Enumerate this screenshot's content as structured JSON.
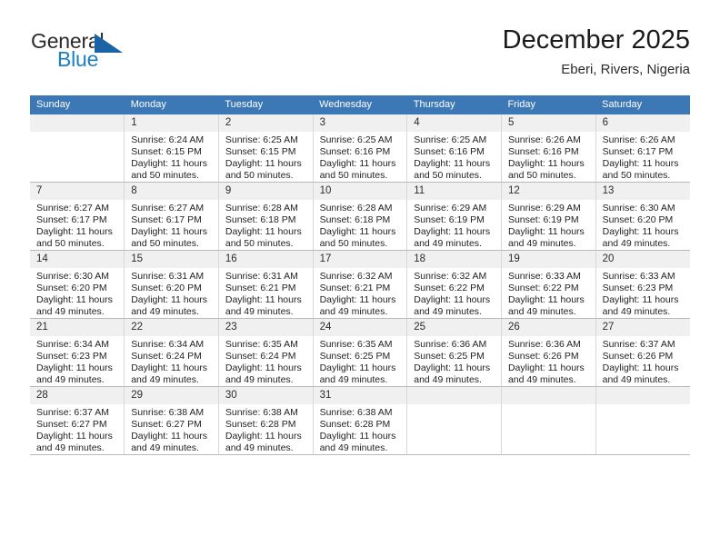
{
  "brand": {
    "word1": "General",
    "word2": "Blue",
    "flag_icon": "blue-triangle-flag-icon",
    "colors": {
      "general": "#2b2b2b",
      "blue": "#1d7fc3",
      "flag": "#1b63a5"
    }
  },
  "header": {
    "title": "December 2025",
    "subtitle": "Eberi, Rivers, Nigeria"
  },
  "theme": {
    "header_row_bg": "#3b78b5",
    "header_row_text": "#ffffff",
    "daynum_bg": "#f0f0f0",
    "cell_border": "#d8d8d8"
  },
  "weekdays": [
    "Sunday",
    "Monday",
    "Tuesday",
    "Wednesday",
    "Thursday",
    "Friday",
    "Saturday"
  ],
  "weeks": [
    [
      {
        "day": "",
        "sunrise": "",
        "sunset": "",
        "daylight_line1": "",
        "daylight_line2": ""
      },
      {
        "day": "1",
        "sunrise": "Sunrise: 6:24 AM",
        "sunset": "Sunset: 6:15 PM",
        "daylight_line1": "Daylight: 11 hours",
        "daylight_line2": "and 50 minutes."
      },
      {
        "day": "2",
        "sunrise": "Sunrise: 6:25 AM",
        "sunset": "Sunset: 6:15 PM",
        "daylight_line1": "Daylight: 11 hours",
        "daylight_line2": "and 50 minutes."
      },
      {
        "day": "3",
        "sunrise": "Sunrise: 6:25 AM",
        "sunset": "Sunset: 6:16 PM",
        "daylight_line1": "Daylight: 11 hours",
        "daylight_line2": "and 50 minutes."
      },
      {
        "day": "4",
        "sunrise": "Sunrise: 6:25 AM",
        "sunset": "Sunset: 6:16 PM",
        "daylight_line1": "Daylight: 11 hours",
        "daylight_line2": "and 50 minutes."
      },
      {
        "day": "5",
        "sunrise": "Sunrise: 6:26 AM",
        "sunset": "Sunset: 6:16 PM",
        "daylight_line1": "Daylight: 11 hours",
        "daylight_line2": "and 50 minutes."
      },
      {
        "day": "6",
        "sunrise": "Sunrise: 6:26 AM",
        "sunset": "Sunset: 6:17 PM",
        "daylight_line1": "Daylight: 11 hours",
        "daylight_line2": "and 50 minutes."
      }
    ],
    [
      {
        "day": "7",
        "sunrise": "Sunrise: 6:27 AM",
        "sunset": "Sunset: 6:17 PM",
        "daylight_line1": "Daylight: 11 hours",
        "daylight_line2": "and 50 minutes."
      },
      {
        "day": "8",
        "sunrise": "Sunrise: 6:27 AM",
        "sunset": "Sunset: 6:17 PM",
        "daylight_line1": "Daylight: 11 hours",
        "daylight_line2": "and 50 minutes."
      },
      {
        "day": "9",
        "sunrise": "Sunrise: 6:28 AM",
        "sunset": "Sunset: 6:18 PM",
        "daylight_line1": "Daylight: 11 hours",
        "daylight_line2": "and 50 minutes."
      },
      {
        "day": "10",
        "sunrise": "Sunrise: 6:28 AM",
        "sunset": "Sunset: 6:18 PM",
        "daylight_line1": "Daylight: 11 hours",
        "daylight_line2": "and 50 minutes."
      },
      {
        "day": "11",
        "sunrise": "Sunrise: 6:29 AM",
        "sunset": "Sunset: 6:19 PM",
        "daylight_line1": "Daylight: 11 hours",
        "daylight_line2": "and 49 minutes."
      },
      {
        "day": "12",
        "sunrise": "Sunrise: 6:29 AM",
        "sunset": "Sunset: 6:19 PM",
        "daylight_line1": "Daylight: 11 hours",
        "daylight_line2": "and 49 minutes."
      },
      {
        "day": "13",
        "sunrise": "Sunrise: 6:30 AM",
        "sunset": "Sunset: 6:20 PM",
        "daylight_line1": "Daylight: 11 hours",
        "daylight_line2": "and 49 minutes."
      }
    ],
    [
      {
        "day": "14",
        "sunrise": "Sunrise: 6:30 AM",
        "sunset": "Sunset: 6:20 PM",
        "daylight_line1": "Daylight: 11 hours",
        "daylight_line2": "and 49 minutes."
      },
      {
        "day": "15",
        "sunrise": "Sunrise: 6:31 AM",
        "sunset": "Sunset: 6:20 PM",
        "daylight_line1": "Daylight: 11 hours",
        "daylight_line2": "and 49 minutes."
      },
      {
        "day": "16",
        "sunrise": "Sunrise: 6:31 AM",
        "sunset": "Sunset: 6:21 PM",
        "daylight_line1": "Daylight: 11 hours",
        "daylight_line2": "and 49 minutes."
      },
      {
        "day": "17",
        "sunrise": "Sunrise: 6:32 AM",
        "sunset": "Sunset: 6:21 PM",
        "daylight_line1": "Daylight: 11 hours",
        "daylight_line2": "and 49 minutes."
      },
      {
        "day": "18",
        "sunrise": "Sunrise: 6:32 AM",
        "sunset": "Sunset: 6:22 PM",
        "daylight_line1": "Daylight: 11 hours",
        "daylight_line2": "and 49 minutes."
      },
      {
        "day": "19",
        "sunrise": "Sunrise: 6:33 AM",
        "sunset": "Sunset: 6:22 PM",
        "daylight_line1": "Daylight: 11 hours",
        "daylight_line2": "and 49 minutes."
      },
      {
        "day": "20",
        "sunrise": "Sunrise: 6:33 AM",
        "sunset": "Sunset: 6:23 PM",
        "daylight_line1": "Daylight: 11 hours",
        "daylight_line2": "and 49 minutes."
      }
    ],
    [
      {
        "day": "21",
        "sunrise": "Sunrise: 6:34 AM",
        "sunset": "Sunset: 6:23 PM",
        "daylight_line1": "Daylight: 11 hours",
        "daylight_line2": "and 49 minutes."
      },
      {
        "day": "22",
        "sunrise": "Sunrise: 6:34 AM",
        "sunset": "Sunset: 6:24 PM",
        "daylight_line1": "Daylight: 11 hours",
        "daylight_line2": "and 49 minutes."
      },
      {
        "day": "23",
        "sunrise": "Sunrise: 6:35 AM",
        "sunset": "Sunset: 6:24 PM",
        "daylight_line1": "Daylight: 11 hours",
        "daylight_line2": "and 49 minutes."
      },
      {
        "day": "24",
        "sunrise": "Sunrise: 6:35 AM",
        "sunset": "Sunset: 6:25 PM",
        "daylight_line1": "Daylight: 11 hours",
        "daylight_line2": "and 49 minutes."
      },
      {
        "day": "25",
        "sunrise": "Sunrise: 6:36 AM",
        "sunset": "Sunset: 6:25 PM",
        "daylight_line1": "Daylight: 11 hours",
        "daylight_line2": "and 49 minutes."
      },
      {
        "day": "26",
        "sunrise": "Sunrise: 6:36 AM",
        "sunset": "Sunset: 6:26 PM",
        "daylight_line1": "Daylight: 11 hours",
        "daylight_line2": "and 49 minutes."
      },
      {
        "day": "27",
        "sunrise": "Sunrise: 6:37 AM",
        "sunset": "Sunset: 6:26 PM",
        "daylight_line1": "Daylight: 11 hours",
        "daylight_line2": "and 49 minutes."
      }
    ],
    [
      {
        "day": "28",
        "sunrise": "Sunrise: 6:37 AM",
        "sunset": "Sunset: 6:27 PM",
        "daylight_line1": "Daylight: 11 hours",
        "daylight_line2": "and 49 minutes."
      },
      {
        "day": "29",
        "sunrise": "Sunrise: 6:38 AM",
        "sunset": "Sunset: 6:27 PM",
        "daylight_line1": "Daylight: 11 hours",
        "daylight_line2": "and 49 minutes."
      },
      {
        "day": "30",
        "sunrise": "Sunrise: 6:38 AM",
        "sunset": "Sunset: 6:28 PM",
        "daylight_line1": "Daylight: 11 hours",
        "daylight_line2": "and 49 minutes."
      },
      {
        "day": "31",
        "sunrise": "Sunrise: 6:38 AM",
        "sunset": "Sunset: 6:28 PM",
        "daylight_line1": "Daylight: 11 hours",
        "daylight_line2": "and 49 minutes."
      },
      {
        "day": "",
        "sunrise": "",
        "sunset": "",
        "daylight_line1": "",
        "daylight_line2": ""
      },
      {
        "day": "",
        "sunrise": "",
        "sunset": "",
        "daylight_line1": "",
        "daylight_line2": ""
      },
      {
        "day": "",
        "sunrise": "",
        "sunset": "",
        "daylight_line1": "",
        "daylight_line2": ""
      }
    ]
  ]
}
